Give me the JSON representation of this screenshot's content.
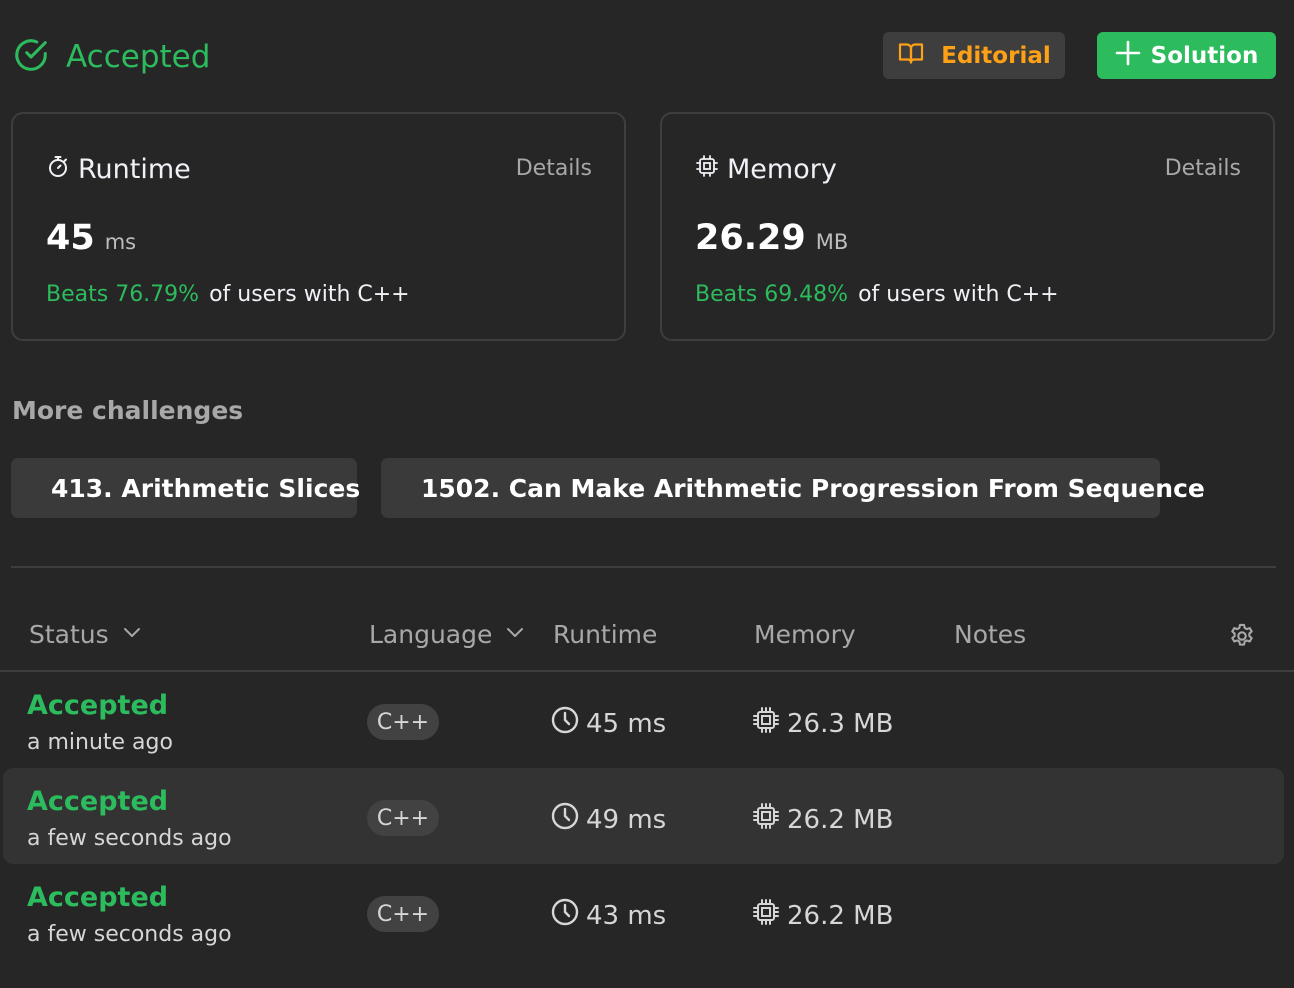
{
  "header": {
    "status": "Accepted",
    "editorial_label": "Editorial",
    "solution_label": "Solution"
  },
  "runtime_card": {
    "title": "Runtime",
    "details": "Details",
    "value": "45",
    "unit": "ms",
    "beats": "Beats 76.79%",
    "beats_suffix": "of users with C++"
  },
  "memory_card": {
    "title": "Memory",
    "details": "Details",
    "value": "26.29",
    "unit": "MB",
    "beats": "Beats 69.48%",
    "beats_suffix": "of users with C++"
  },
  "more_challenges": {
    "title": "More challenges",
    "items": [
      {
        "label": "413. Arithmetic Slices",
        "dot_color": "#ffb800"
      },
      {
        "label": "1502. Can Make Arithmetic Progression From Sequence",
        "dot_color": "#00b8a3"
      }
    ]
  },
  "table": {
    "headers": {
      "status": "Status",
      "language": "Language",
      "runtime": "Runtime",
      "memory": "Memory",
      "notes": "Notes"
    },
    "rows": [
      {
        "status": "Accepted",
        "time": "a minute ago",
        "language": "C++",
        "runtime": "45 ms",
        "memory": "26.3 MB"
      },
      {
        "status": "Accepted",
        "time": "a few seconds ago",
        "language": "C++",
        "runtime": "49 ms",
        "memory": "26.2 MB"
      },
      {
        "status": "Accepted",
        "time": "a few seconds ago",
        "language": "C++",
        "runtime": "43 ms",
        "memory": "26.2 MB"
      }
    ]
  },
  "colors": {
    "accent_green": "#2cbb5d",
    "accent_orange": "#ffa116",
    "background": "#262626"
  },
  "icons": {
    "status": "check-circle-icon",
    "editorial": "book-open-icon",
    "solution": "plus-icon",
    "runtime": "stopwatch-icon",
    "memory": "cpu-chip-icon",
    "sort": "chevron-down-icon",
    "settings": "gear-icon",
    "row_runtime": "clock-icon",
    "row_memory": "cpu-chip-icon"
  }
}
